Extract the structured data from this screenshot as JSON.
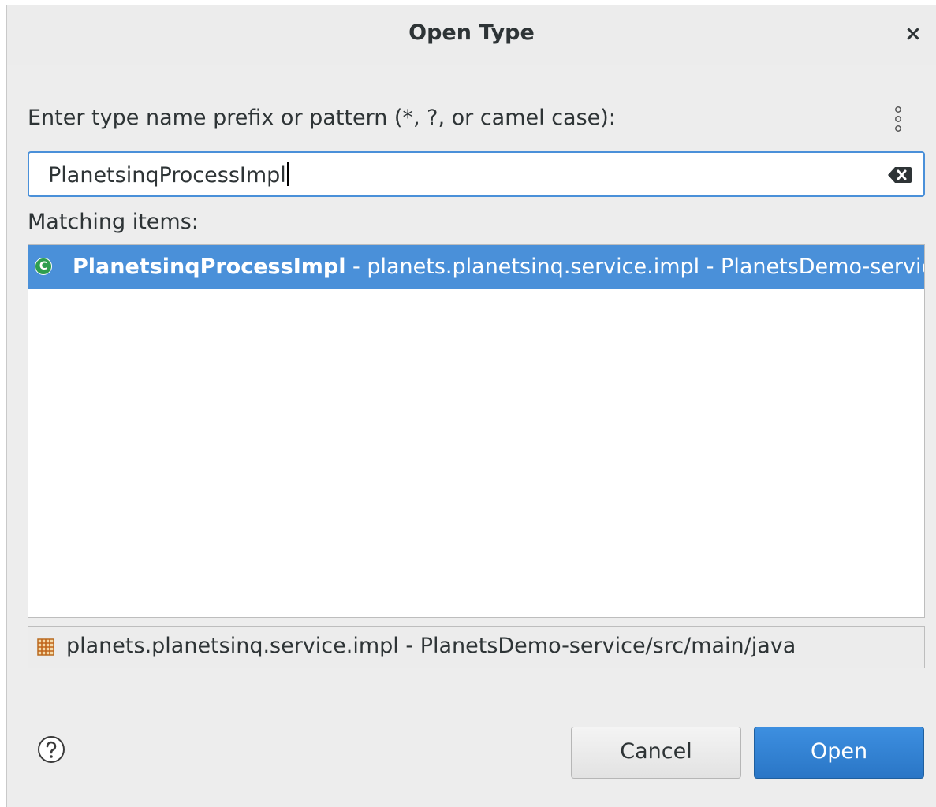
{
  "dialog": {
    "title": "Open Type",
    "close_glyph": "×"
  },
  "search": {
    "label": "Enter type name prefix or pattern (*, ?, or camel case):",
    "value": "PlanetsinqProcessImpl",
    "menu_icon": "kebab-menu-icon",
    "clear_icon": "backspace-clear-icon"
  },
  "results": {
    "label": "Matching items:",
    "items": [
      {
        "icon": "class-icon",
        "icon_glyph": "C",
        "name": "PlanetsinqProcessImpl",
        "detail": " - planets.planetsinq.service.impl - PlanetsDemo-service/src/",
        "selected": true
      }
    ]
  },
  "status": {
    "icon": "package-icon",
    "text": "planets.planetsinq.service.impl - PlanetsDemo-service/src/main/java"
  },
  "footer": {
    "help_icon": "help-icon",
    "cancel_label": "Cancel",
    "open_label": "Open"
  },
  "colors": {
    "accent": "#4a90d9",
    "open_button": "#2a76c6",
    "class_icon": "#2e9e4f"
  }
}
